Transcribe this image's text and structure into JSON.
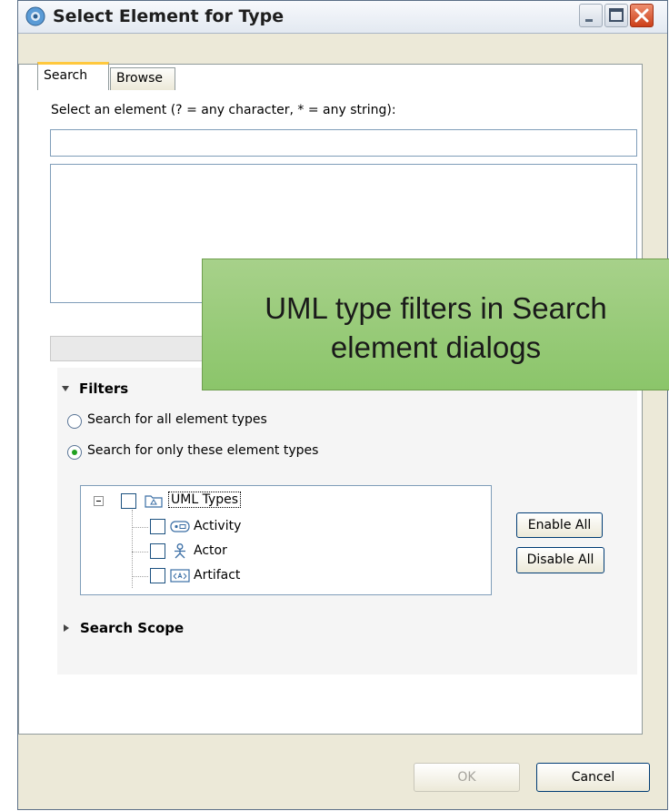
{
  "window": {
    "title": "Select Element for Type",
    "controls": [
      "minimize-icon",
      "maximize-icon",
      "close-icon"
    ]
  },
  "tabs": [
    {
      "label": "Search",
      "active": true
    },
    {
      "label": "Browse",
      "active": false
    }
  ],
  "search": {
    "prompt": "Select an element (? = any character, * = any string):",
    "value": ""
  },
  "filters": {
    "heading": "Filters",
    "radio_all": {
      "label": "Search for all element types",
      "selected": false
    },
    "radio_only": {
      "label": "Search for only these element types",
      "selected": true
    },
    "tree": {
      "root": {
        "label": "UML Types",
        "icon": "folder-icon",
        "checked": false
      },
      "items": [
        {
          "label": "Activity",
          "icon": "activity-icon",
          "checked": false
        },
        {
          "label": "Actor",
          "icon": "actor-icon",
          "checked": false
        },
        {
          "label": "Artifact",
          "icon": "artifact-icon",
          "checked": false
        }
      ]
    },
    "enable_all": "Enable All",
    "disable_all": "Disable All"
  },
  "scope": {
    "heading": "Search Scope"
  },
  "footer": {
    "ok": "OK",
    "cancel": "Cancel",
    "ok_enabled": false
  },
  "callout": {
    "line1": "UML type filters in Search",
    "line2": "element dialogs"
  },
  "colors": {
    "callout_green": "#9ccc7c",
    "dialog_bg": "#ece9d8",
    "close_red": "#d9532b"
  }
}
